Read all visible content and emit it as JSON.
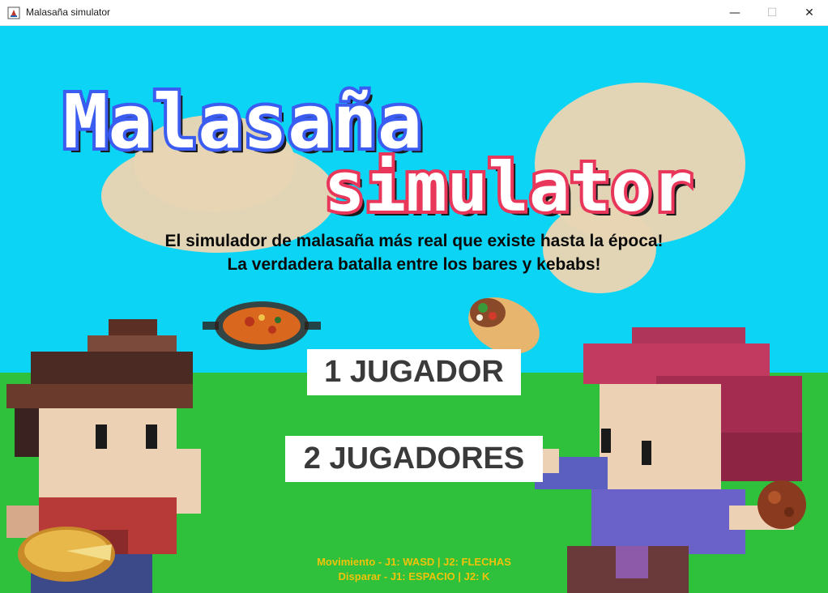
{
  "window": {
    "title": "Malasaña simulator",
    "minimize_glyph": "—",
    "maximize_glyph": "☐",
    "close_glyph": "✕"
  },
  "logo": {
    "line1": "Malasaña",
    "line2": "simulator",
    "line1_fill": "#ffffff",
    "line1_outline": "#3b5cf0",
    "line2_fill": "#ffffff",
    "line2_outline": "#e8375a"
  },
  "subtitle": {
    "line1": "El simulador de malasaña más real que existe hasta la época!",
    "line2": "La verdadera batalla entre los bares y kebabs!"
  },
  "menu": {
    "one_player": "1 JUGADOR",
    "two_players": "2 JUGADORES"
  },
  "controls": {
    "movement": "Movimiento - J1: WASD  | J2: FLECHAS",
    "shoot": "Disparar - J1: ESPACIO  | J2: K"
  },
  "colors": {
    "sky": "#0bd4f5",
    "grass": "#2fc13b",
    "controls_text": "#f2c20a"
  },
  "sprites": {
    "left_character": "brown-haired-boy-sprite",
    "right_character": "red-haired-kebab-guy-sprite",
    "paella": "paella-pan-icon",
    "kebab": "kebab-wrap-icon",
    "tortilla": "tortilla-icon",
    "falafel": "falafel-ball-icon"
  }
}
